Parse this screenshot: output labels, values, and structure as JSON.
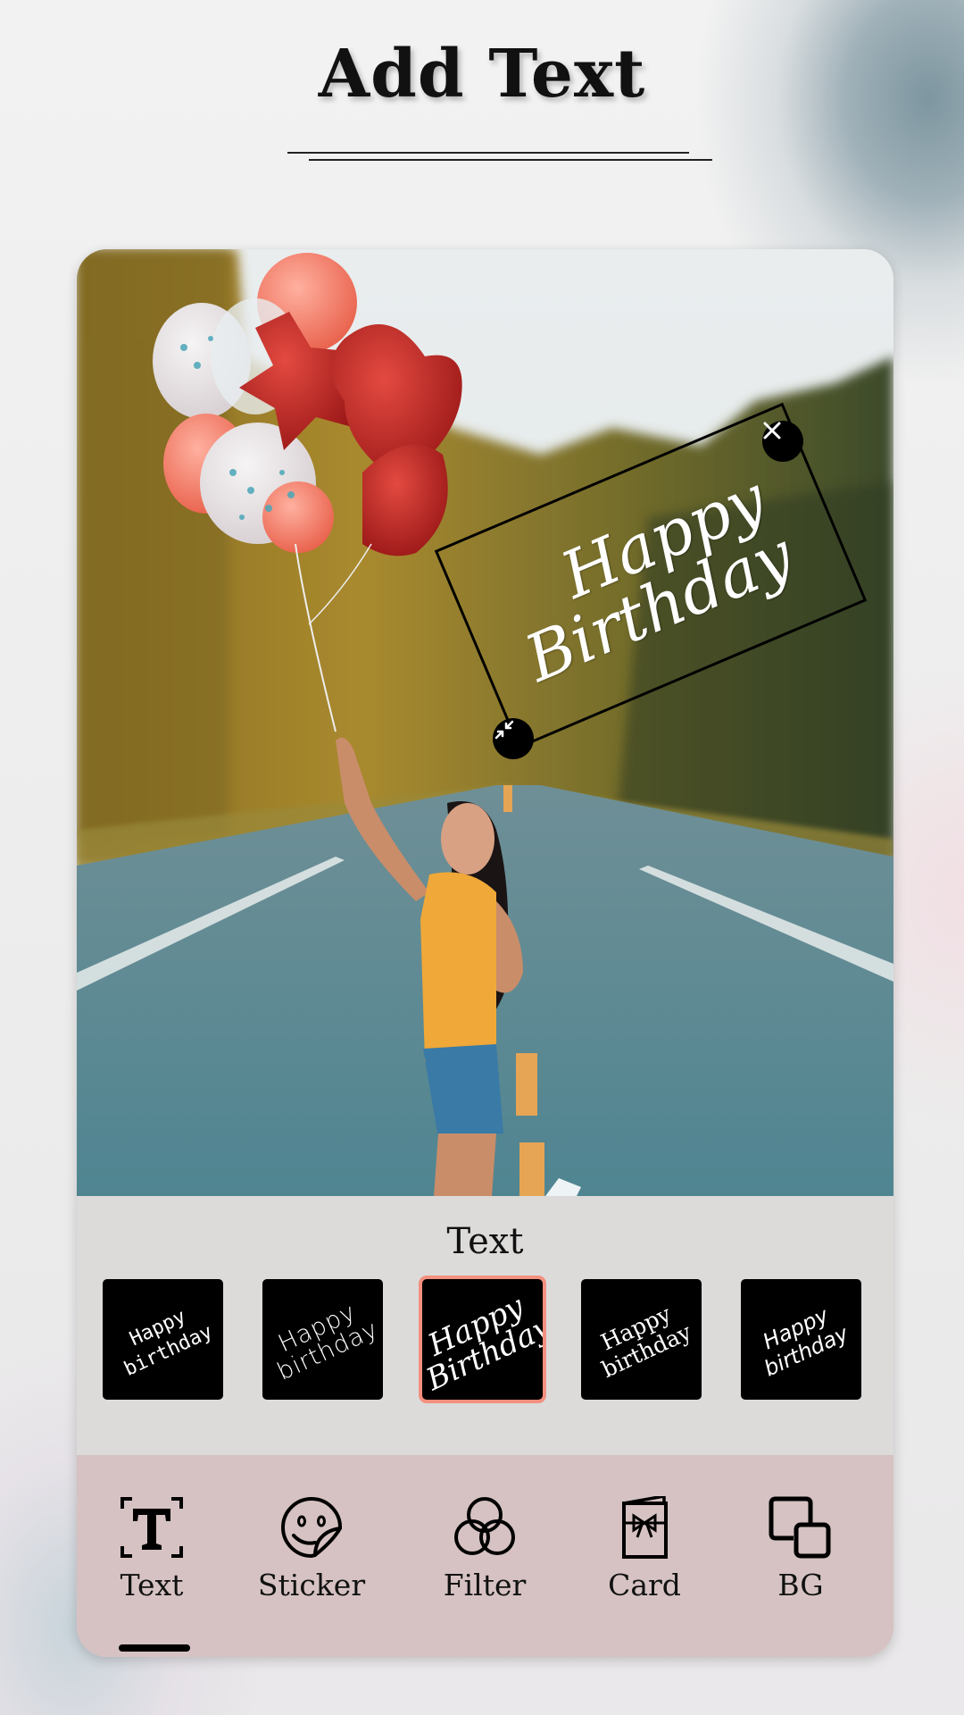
{
  "header": {
    "title": "Add Text"
  },
  "canvas": {
    "photo_description": "Woman in orange top holding balloons on a forest road",
    "sticker": {
      "line1": "Happy",
      "line2": "Birthday",
      "close_icon": "close-icon",
      "resize_icon": "resize-icon"
    }
  },
  "text_panel": {
    "title": "Text",
    "styles": [
      {
        "line1": "Happy",
        "line2": "birthday",
        "selected": false
      },
      {
        "line1": "Happy",
        "line2": "birthday",
        "selected": false
      },
      {
        "line1": "Happy",
        "line2": "Birthday",
        "selected": true
      },
      {
        "line1": "Happy",
        "line2": "birthday",
        "selected": false
      },
      {
        "line1": "Happy",
        "line2": "birthday",
        "selected": false
      }
    ],
    "selected_color": "#f3907f"
  },
  "toolbar": {
    "items": [
      {
        "label": "Text",
        "icon": "text-icon",
        "active": true
      },
      {
        "label": "Sticker",
        "icon": "sticker-icon",
        "active": false
      },
      {
        "label": "Filter",
        "icon": "filter-icon",
        "active": false
      },
      {
        "label": "Card",
        "icon": "card-icon",
        "active": false
      },
      {
        "label": "BG",
        "icon": "background-icon",
        "active": false
      }
    ],
    "background_color": "#d6c2c2"
  }
}
